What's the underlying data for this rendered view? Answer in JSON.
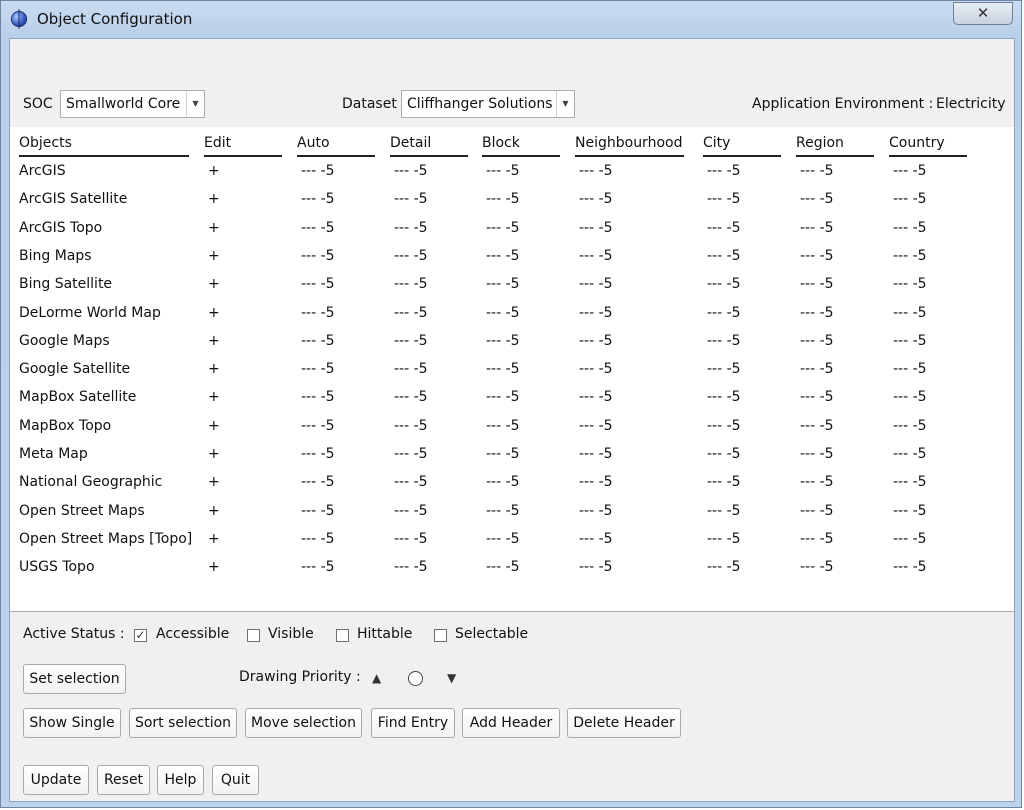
{
  "window": {
    "title": "Object Configuration",
    "close_glyph": "✕"
  },
  "toolbar": {
    "soc_label": "SOC",
    "soc_value": "Smallworld Core",
    "dataset_label": "Dataset",
    "dataset_value": "Cliffhanger Solutions",
    "app_env_label": "Application Environment :",
    "app_env_value": "Electricity"
  },
  "table": {
    "columns": [
      "Objects",
      "Edit",
      "Auto",
      "Detail",
      "Block",
      "Neighbourhood",
      "City",
      "Region",
      "Country"
    ],
    "rows": [
      {
        "name": "ArcGIS",
        "edit": "+",
        "auto": "--- -5",
        "detail": "--- -5",
        "block": "--- -5",
        "neighbourhood": "--- -5",
        "city": "--- -5",
        "region": "--- -5",
        "country": "--- -5"
      },
      {
        "name": "ArcGIS Satellite",
        "edit": "+",
        "auto": "--- -5",
        "detail": "--- -5",
        "block": "--- -5",
        "neighbourhood": "--- -5",
        "city": "--- -5",
        "region": "--- -5",
        "country": "--- -5"
      },
      {
        "name": "ArcGIS Topo",
        "edit": "+",
        "auto": "--- -5",
        "detail": "--- -5",
        "block": "--- -5",
        "neighbourhood": "--- -5",
        "city": "--- -5",
        "region": "--- -5",
        "country": "--- -5"
      },
      {
        "name": "Bing Maps",
        "edit": "+",
        "auto": "--- -5",
        "detail": "--- -5",
        "block": "--- -5",
        "neighbourhood": "--- -5",
        "city": "--- -5",
        "region": "--- -5",
        "country": "--- -5"
      },
      {
        "name": "Bing Satellite",
        "edit": "+",
        "auto": "--- -5",
        "detail": "--- -5",
        "block": "--- -5",
        "neighbourhood": "--- -5",
        "city": "--- -5",
        "region": "--- -5",
        "country": "--- -5"
      },
      {
        "name": "DeLorme World Map",
        "edit": "+",
        "auto": "--- -5",
        "detail": "--- -5",
        "block": "--- -5",
        "neighbourhood": "--- -5",
        "city": "--- -5",
        "region": "--- -5",
        "country": "--- -5"
      },
      {
        "name": "Google Maps",
        "edit": "+",
        "auto": "--- -5",
        "detail": "--- -5",
        "block": "--- -5",
        "neighbourhood": "--- -5",
        "city": "--- -5",
        "region": "--- -5",
        "country": "--- -5"
      },
      {
        "name": "Google Satellite",
        "edit": "+",
        "auto": "--- -5",
        "detail": "--- -5",
        "block": "--- -5",
        "neighbourhood": "--- -5",
        "city": "--- -5",
        "region": "--- -5",
        "country": "--- -5"
      },
      {
        "name": "MapBox Satellite",
        "edit": "+",
        "auto": "--- -5",
        "detail": "--- -5",
        "block": "--- -5",
        "neighbourhood": "--- -5",
        "city": "--- -5",
        "region": "--- -5",
        "country": "--- -5"
      },
      {
        "name": "MapBox Topo",
        "edit": "+",
        "auto": "--- -5",
        "detail": "--- -5",
        "block": "--- -5",
        "neighbourhood": "--- -5",
        "city": "--- -5",
        "region": "--- -5",
        "country": "--- -5"
      },
      {
        "name": "Meta Map",
        "edit": "+",
        "auto": "--- -5",
        "detail": "--- -5",
        "block": "--- -5",
        "neighbourhood": "--- -5",
        "city": "--- -5",
        "region": "--- -5",
        "country": "--- -5"
      },
      {
        "name": "National Geographic",
        "edit": "+",
        "auto": "--- -5",
        "detail": "--- -5",
        "block": "--- -5",
        "neighbourhood": "--- -5",
        "city": "--- -5",
        "region": "--- -5",
        "country": "--- -5"
      },
      {
        "name": "Open Street Maps",
        "edit": "+",
        "auto": "--- -5",
        "detail": "--- -5",
        "block": "--- -5",
        "neighbourhood": "--- -5",
        "city": "--- -5",
        "region": "--- -5",
        "country": "--- -5"
      },
      {
        "name": "Open Street Maps [Topo]",
        "edit": "+",
        "auto": "--- -5",
        "detail": "--- -5",
        "block": "--- -5",
        "neighbourhood": "--- -5",
        "city": "--- -5",
        "region": "--- -5",
        "country": "--- -5"
      },
      {
        "name": "USGS Topo",
        "edit": "+",
        "auto": "--- -5",
        "detail": "--- -5",
        "block": "--- -5",
        "neighbourhood": "--- -5",
        "city": "--- -5",
        "region": "--- -5",
        "country": "--- -5"
      }
    ]
  },
  "status": {
    "label": "Active Status :",
    "checkboxes": [
      {
        "label": "Accessible",
        "checked": true
      },
      {
        "label": "Visible",
        "checked": false
      },
      {
        "label": "Hittable",
        "checked": false
      },
      {
        "label": "Selectable",
        "checked": false
      }
    ]
  },
  "actions": {
    "set_selection": "Set selection",
    "drawing_priority_label": "Drawing Priority :",
    "row_buttons": [
      "Show Single",
      "Sort selection",
      "Move selection",
      "Find Entry",
      "Add Header",
      "Delete Header"
    ],
    "bottom_buttons": [
      "Update",
      "Reset",
      "Help",
      "Quit"
    ]
  }
}
